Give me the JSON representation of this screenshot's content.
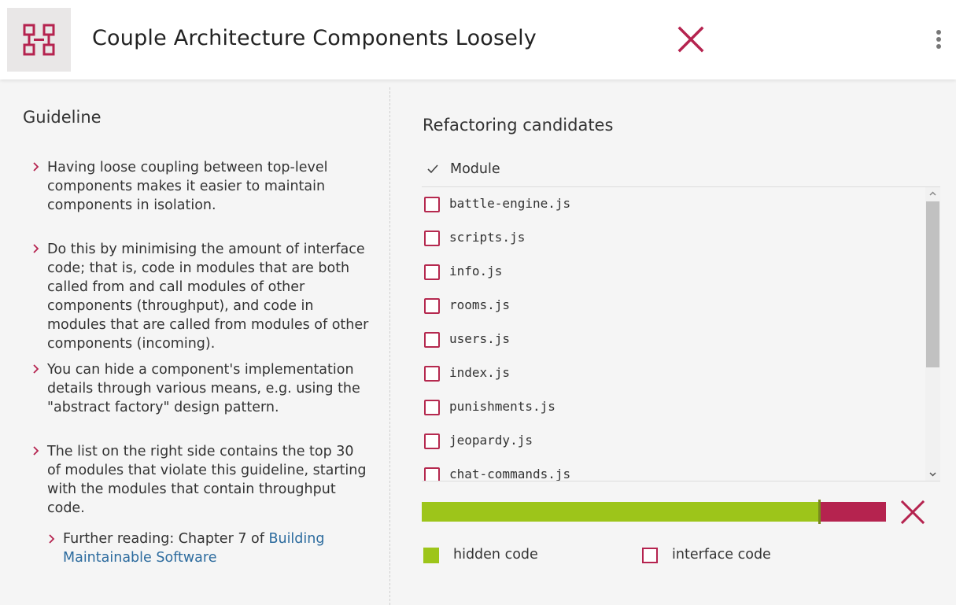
{
  "header": {
    "title": "Couple Architecture Components Loosely",
    "logo_icon": "component-grid-icon",
    "close_icon": "close-icon",
    "menu_icon": "more-vert-icon"
  },
  "guideline": {
    "heading": "Guideline",
    "bullets": [
      "Having loose coupling between top-level components makes it easier to maintain components in isolation.",
      "Do this by minimising the amount of interface code; that is, code in modules that are both called from and call modules of other components (throughput), and code in modules that are called from modules of other components (incoming).",
      "You can hide a component's implementation details through various means, e.g. using the \"abstract factory\" design pattern.",
      "The list on the right side contains the top 30 of modules that violate this guideline, starting with the modules that contain throughput code."
    ],
    "further_prefix": "Further reading: Chapter 7 of ",
    "further_link": "Building Maintainable Software"
  },
  "refactoring": {
    "heading": "Refactoring candidates",
    "column_label": "Module",
    "modules": [
      "battle-engine.js",
      "scripts.js",
      "info.js",
      "rooms.js",
      "users.js",
      "index.js",
      "punishments.js",
      "jeopardy.js",
      "chat-commands.js"
    ]
  },
  "progress": {
    "hidden_fraction": 0.858,
    "legend_hidden": "hidden code",
    "legend_interface": "interface code"
  },
  "colors": {
    "accent": "#b5234f",
    "hidden_code": "#9dc51a",
    "link": "#2c6b9e"
  }
}
